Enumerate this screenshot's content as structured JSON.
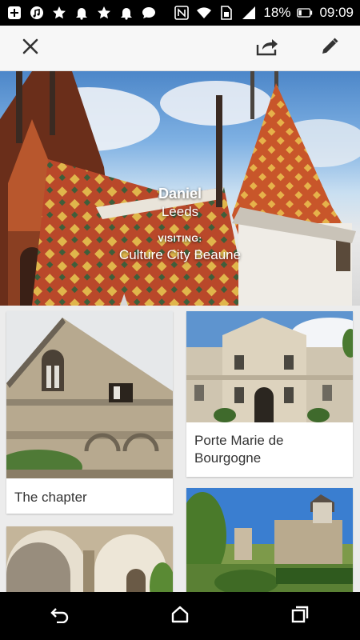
{
  "status_bar": {
    "battery": "18%",
    "time": "09:09",
    "icons": [
      "add-box-icon",
      "music-icon",
      "star-icon",
      "bell-icon",
      "star-icon",
      "bell-icon",
      "chat-icon",
      "nfc-icon",
      "wifi-icon",
      "sim-icon",
      "signal-icon",
      "battery-icon"
    ]
  },
  "toolbar": {
    "close_icon": "close-icon",
    "share_icon": "share-icon",
    "edit_icon": "pencil-icon"
  },
  "hero": {
    "name": "Daniel",
    "home": "Leeds",
    "visiting_label": "VISITING:",
    "destination": "Culture City Beaune"
  },
  "cards": [
    {
      "title": "The chapter"
    },
    {
      "title": "Porte Marie de Bourgogne"
    },
    {
      "title": ""
    },
    {
      "title": ""
    }
  ],
  "nav": {
    "back_icon": "back-icon",
    "home_icon": "home-icon",
    "recents_icon": "recents-icon"
  },
  "colors": {
    "status_bg": "#000000",
    "toolbar_bg": "#f7f7f7",
    "roof_orange": "#c8562a",
    "roof_yellow": "#e0b64b",
    "stone": "#b7a98f"
  }
}
